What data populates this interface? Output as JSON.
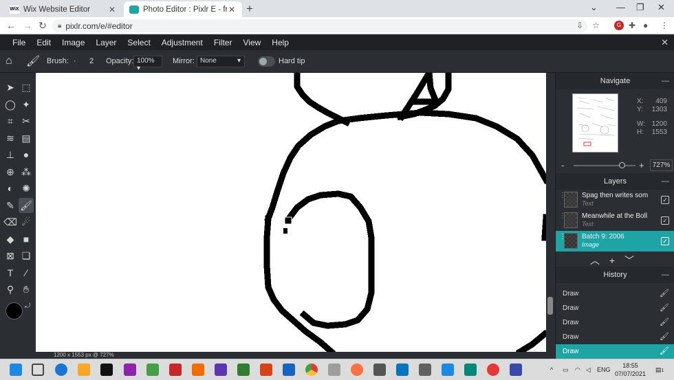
{
  "browser": {
    "tabs": [
      {
        "favicon": "wix",
        "title": "Wix Website Editor"
      },
      {
        "favicon": "pixlr-logo",
        "title": "Photo Editor : Pixlr E - free image"
      }
    ],
    "url": "pixlr.com/e/#editor"
  },
  "menu": [
    "File",
    "Edit",
    "Image",
    "Layer",
    "Select",
    "Adjustment",
    "Filter",
    "View",
    "Help"
  ],
  "options": {
    "brush_label": "Brush:",
    "brush_size": "2",
    "opacity_label": "Opacity:",
    "opacity_value": "100%",
    "mirror_label": "Mirror:",
    "mirror_value": "None",
    "hardtip_label": "Hard tip"
  },
  "navigate": {
    "title": "Navigate",
    "x_label": "X:",
    "x_value": "409",
    "y_label": "Y:",
    "y_value": "1303",
    "w_label": "W:",
    "w_value": "1200",
    "h_label": "H:",
    "h_value": "1553",
    "zoom": "727%"
  },
  "layers": {
    "title": "Layers",
    "items": [
      {
        "name": "Spag then writes som...",
        "type": "Text"
      },
      {
        "name": "Meanwhile at the Boll...",
        "type": "Text"
      },
      {
        "name": "Batch 9: 2006",
        "type": "Image"
      }
    ]
  },
  "history": {
    "title": "History",
    "items": [
      "Draw",
      "Draw",
      "Draw",
      "Draw",
      "Draw"
    ]
  },
  "status_text": "1200 x 1553 px @ 727%",
  "system": {
    "lang": "ENG",
    "time": "18:55",
    "date": "07/07/2021",
    "notifications": "1"
  },
  "colors": {
    "accent": "#1fa4a5",
    "primary": "#000000",
    "secondary": "#d9d9d9"
  }
}
